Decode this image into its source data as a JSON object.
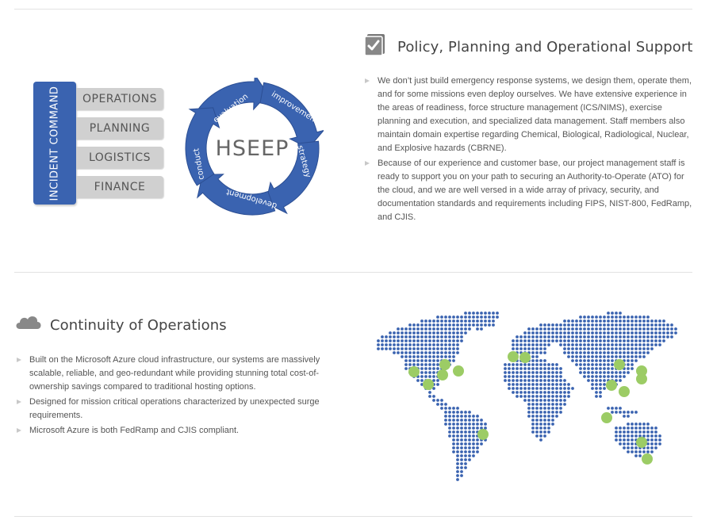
{
  "policy": {
    "title": "Policy, Planning and Operational Support",
    "icon": "checklist-icon",
    "bullets": [
      "We don’t just build emergency response systems, we design them, operate them, and for some missions even deploy ourselves. We have extensive experience in the areas of readiness, force structure management (ICS/NIMS), exercise planning and execution, and specialized data management. Staff members also maintain domain expertise regarding Chemical, Biological, Radiological, Nuclear, and Explosive hazards (CBRNE).",
      "Because of our experience and customer base, our project management staff is ready to support you on your path to securing an Authority-to-Operate (ATO) for the cloud, and we are well versed in a wide array of privacy, security, and documentation standards and requirements including FIPS, NIST-800, FedRamp, and CJIS."
    ]
  },
  "incident_command": {
    "title": "INCIDENT COMMAND",
    "items": [
      "OPERATIONS",
      "PLANNING",
      "LOGISTICS",
      "FINANCE"
    ],
    "color": "#3a63b0"
  },
  "hseep": {
    "center": "HSEEP",
    "stages": [
      "evaluation",
      "improvement",
      "strategy",
      "development",
      "conduct"
    ],
    "color": "#3a63b0"
  },
  "continuity": {
    "title": "Continuity of Operations",
    "icon": "cloud-icon",
    "bullets": [
      "Built on the Microsoft Azure cloud infrastructure, our systems are massively scalable, reliable, and geo-redundant while providing stunning total cost-of-ownership savings compared to traditional hosting options.",
      "Designed for mission critical operations characterized by unexpected surge requirements.",
      "Microsoft Azure is both FedRamp and CJIS compliant."
    ]
  },
  "world_map": {
    "icon": "world-map-icon",
    "dot_color": "#3a63b0",
    "highlight_color": "#9ccc65"
  }
}
